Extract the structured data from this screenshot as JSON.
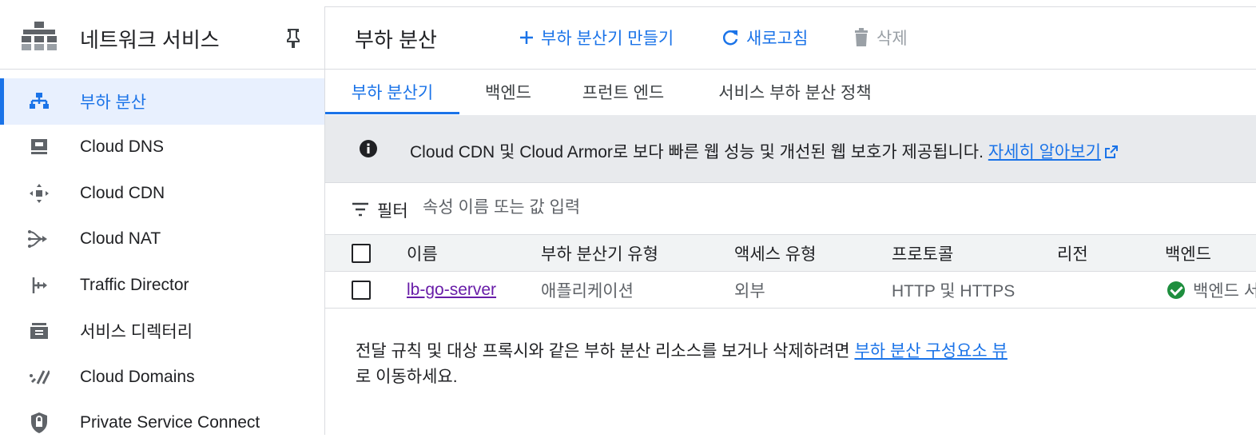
{
  "sidebar": {
    "title": "네트워크 서비스",
    "items": [
      {
        "label": "부하 분산",
        "icon": "load-balancing-icon",
        "active": true
      },
      {
        "label": "Cloud DNS",
        "icon": "dns-icon"
      },
      {
        "label": "Cloud CDN",
        "icon": "cdn-icon"
      },
      {
        "label": "Cloud NAT",
        "icon": "nat-icon"
      },
      {
        "label": "Traffic Director",
        "icon": "traffic-director-icon"
      },
      {
        "label": "서비스 디렉터리",
        "icon": "service-directory-icon"
      },
      {
        "label": "Cloud Domains",
        "icon": "domains-icon"
      },
      {
        "label": "Private Service Connect",
        "icon": "shield-icon"
      }
    ]
  },
  "header": {
    "title": "부하 분산",
    "create_label": "부하 분산기 만들기",
    "refresh_label": "새로고침",
    "delete_label": "삭제"
  },
  "tabs": [
    "부하 분산기",
    "백엔드",
    "프런트 엔드",
    "서비스 부하 분산 정책"
  ],
  "banner": {
    "text": "Cloud CDN 및 Cloud Armor로 보다 빠른 웹 성능 및 개선된 웹 보호가 제공됩니다.",
    "link": "자세히 알아보기"
  },
  "filter": {
    "label": "필터",
    "placeholder": "속성 이름 또는 값 입력"
  },
  "table": {
    "columns": [
      "이름",
      "부하 분산기 유형",
      "액세스 유형",
      "프로토콜",
      "리전",
      "백엔드"
    ],
    "rows": [
      {
        "name": "lb-go-server",
        "type": "애플리케이션",
        "access": "외부",
        "protocol": "HTTP 및 HTTPS",
        "region": "",
        "backend": "백엔드 서"
      }
    ]
  },
  "note": {
    "text_before": "전달 규칙 및 대상 프록시와 같은 부하 분산 리소스를 보거나 삭제하려면 ",
    "link": "부하 분산 구성요소 뷰",
    "text_after": "로 이동하세요."
  },
  "colors": {
    "accent": "#1a73e8",
    "active_bg": "#e8f0fe",
    "banner_bg": "#e8eaed",
    "visited_link": "#681da8",
    "success": "#1e8e3e"
  }
}
